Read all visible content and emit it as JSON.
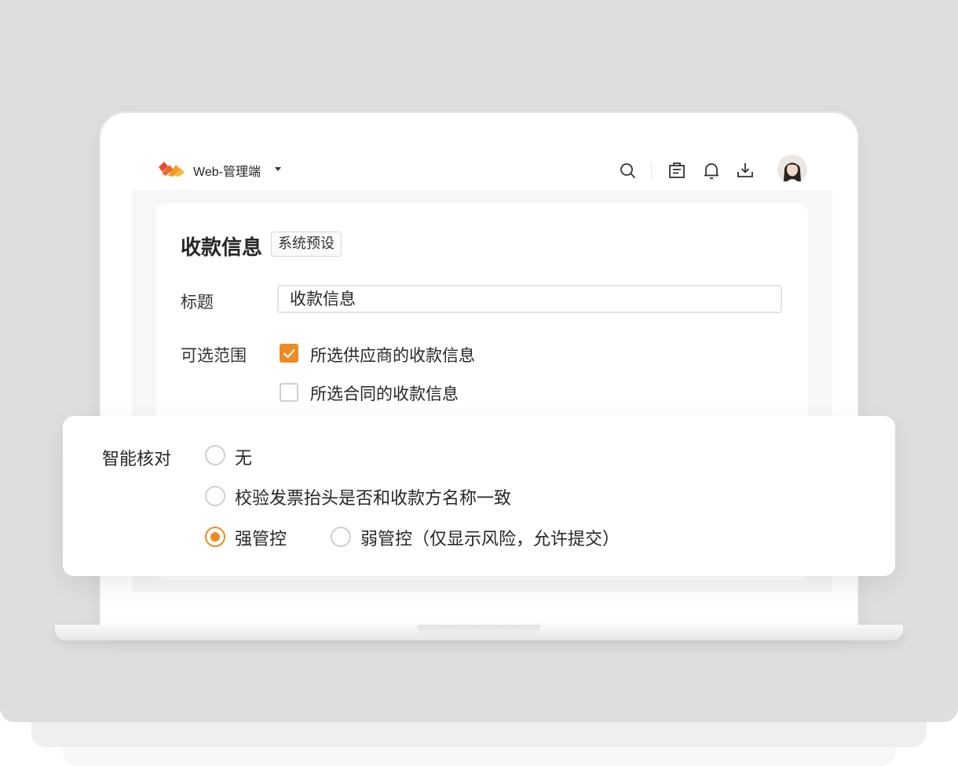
{
  "app": {
    "name": "Web-管理端",
    "accent_color": "#f08a24"
  },
  "topbar": {
    "icons": [
      "search-icon",
      "clipboard-icon",
      "bell-icon",
      "download-icon"
    ],
    "avatar": "user-avatar"
  },
  "form": {
    "title": "收款信息",
    "tag": "系统预设",
    "title_field": {
      "label": "标题",
      "value": "收款信息"
    },
    "scope": {
      "label": "可选范围",
      "options": [
        {
          "label": "所选供应商的收款信息",
          "checked": true
        },
        {
          "label": "所选合同的收款信息",
          "checked": false
        }
      ]
    }
  },
  "popup": {
    "label": "智能核对",
    "options": [
      {
        "label": "无",
        "selected": false
      },
      {
        "label": "校验发票抬头是否和收款方名称一致",
        "selected": false
      },
      {
        "label": "强管控",
        "selected": true
      },
      {
        "label": "弱管控（仅显示风险，允许提交）",
        "selected": false
      }
    ]
  }
}
